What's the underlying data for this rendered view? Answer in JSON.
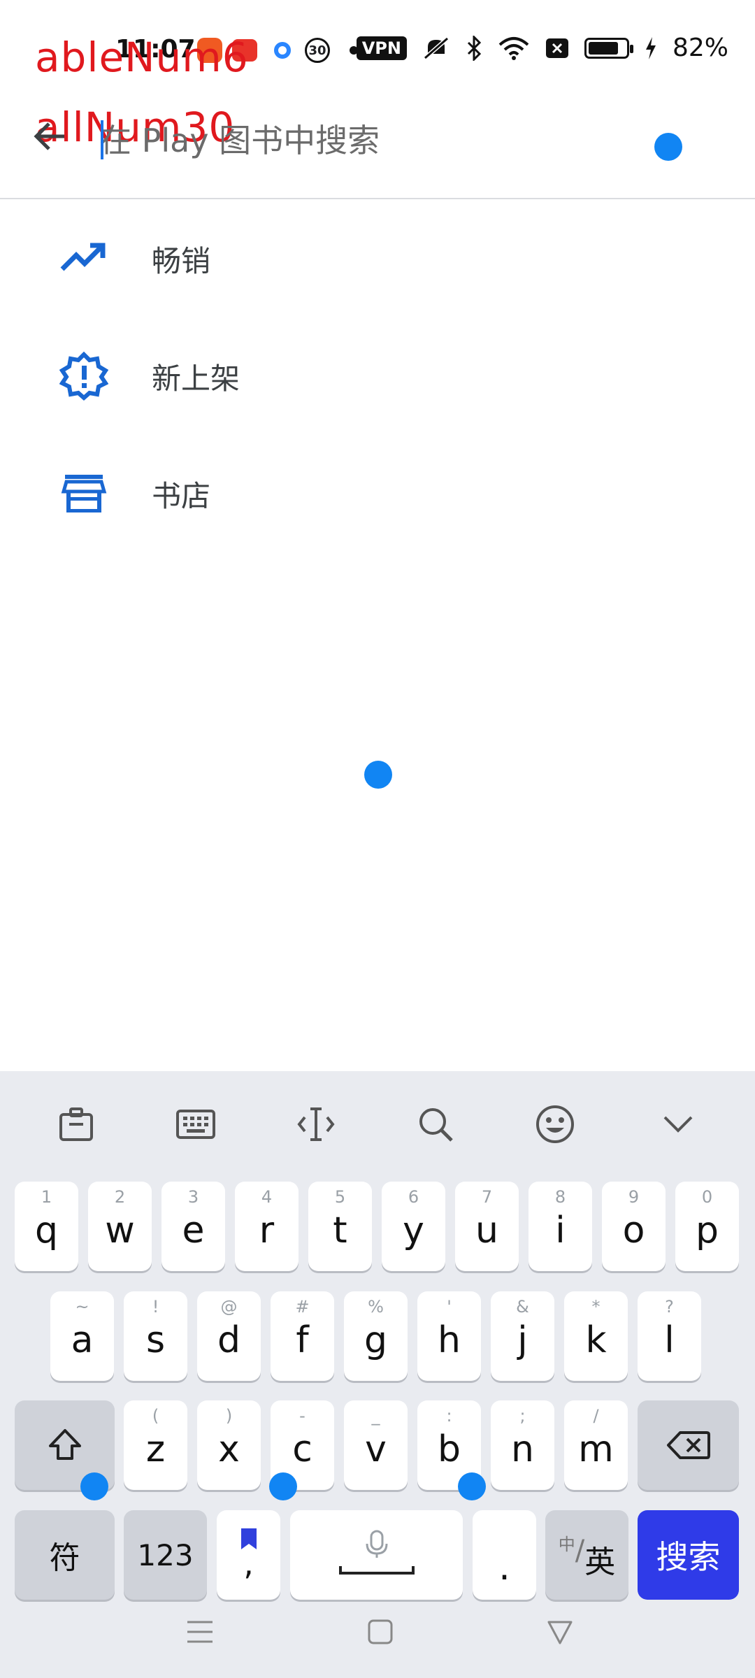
{
  "status_bar": {
    "time": "11:07",
    "vpn": "VPN",
    "battery_percent": "82%",
    "battery_level": 0.82,
    "app_badge": "30"
  },
  "overlay_debug": {
    "line1": "ableNum6",
    "line2": "allNum30"
  },
  "search": {
    "placeholder": "在 Play 图书中搜索",
    "value": ""
  },
  "suggestions": [
    {
      "label": "畅销",
      "icon": "trending-up-icon"
    },
    {
      "label": "新上架",
      "icon": "new-badge-icon"
    },
    {
      "label": "书店",
      "icon": "store-icon"
    }
  ],
  "keyboard": {
    "toolbar": [
      "clipboard-icon",
      "keyboard-icon",
      "cursor-icon",
      "search-icon",
      "emoji-icon",
      "collapse-icon"
    ],
    "row1": [
      {
        "key": "q",
        "hint": "1"
      },
      {
        "key": "w",
        "hint": "2"
      },
      {
        "key": "e",
        "hint": "3"
      },
      {
        "key": "r",
        "hint": "4"
      },
      {
        "key": "t",
        "hint": "5"
      },
      {
        "key": "y",
        "hint": "6"
      },
      {
        "key": "u",
        "hint": "7"
      },
      {
        "key": "i",
        "hint": "8"
      },
      {
        "key": "o",
        "hint": "9"
      },
      {
        "key": "p",
        "hint": "0"
      }
    ],
    "row2": [
      {
        "key": "a",
        "hint": "~"
      },
      {
        "key": "s",
        "hint": "!"
      },
      {
        "key": "d",
        "hint": "@"
      },
      {
        "key": "f",
        "hint": "#"
      },
      {
        "key": "g",
        "hint": "%"
      },
      {
        "key": "h",
        "hint": "'"
      },
      {
        "key": "j",
        "hint": "&"
      },
      {
        "key": "k",
        "hint": "*"
      },
      {
        "key": "l",
        "hint": "?"
      }
    ],
    "row3": [
      {
        "key": "z",
        "hint": "("
      },
      {
        "key": "x",
        "hint": ")"
      },
      {
        "key": "c",
        "hint": "-"
      },
      {
        "key": "v",
        "hint": "_"
      },
      {
        "key": "b",
        "hint": ":"
      },
      {
        "key": "n",
        "hint": ";"
      },
      {
        "key": "m",
        "hint": "/"
      }
    ],
    "symbols_label": "符",
    "numbers_label": "123",
    "comma_label": ",",
    "period_label": ".",
    "lang_small": "中",
    "lang_label": "英",
    "search_label": "搜索"
  }
}
